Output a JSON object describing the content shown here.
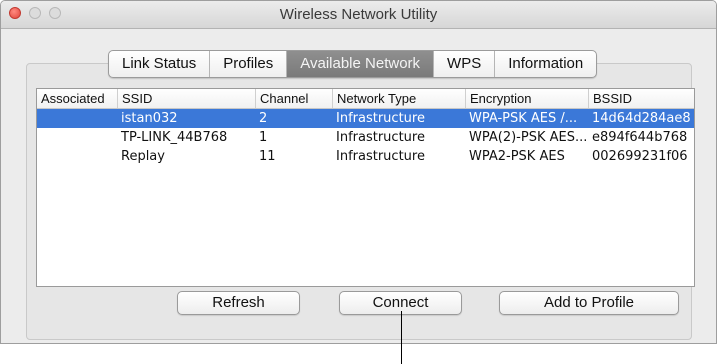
{
  "window": {
    "title": "Wireless Network Utility"
  },
  "tabs": [
    {
      "label": "Link Status",
      "active": false
    },
    {
      "label": "Profiles",
      "active": false
    },
    {
      "label": "Available Network",
      "active": true
    },
    {
      "label": "WPS",
      "active": false
    },
    {
      "label": "Information",
      "active": false
    }
  ],
  "table": {
    "columns": [
      "Associated",
      "SSID",
      "Channel",
      "Network Type",
      "Encryption",
      "BSSID"
    ],
    "rows": [
      {
        "associated": "",
        "ssid": "istan032",
        "channel": "2",
        "type": "Infrastructure",
        "encryption": "WPA-PSK AES /...",
        "bssid": "14d64d284ae8",
        "selected": true
      },
      {
        "associated": "",
        "ssid": "TP-LINK_44B768",
        "channel": "1",
        "type": "Infrastructure",
        "encryption": "WPA(2)-PSK AES...",
        "bssid": "e894f644b768",
        "selected": false
      },
      {
        "associated": "",
        "ssid": "Replay",
        "channel": "11",
        "type": "Infrastructure",
        "encryption": "WPA2-PSK AES",
        "bssid": "002699231f06",
        "selected": false
      }
    ]
  },
  "buttons": {
    "refresh": "Refresh",
    "connect": "Connect",
    "add_to_profile": "Add to Profile"
  },
  "colors": {
    "selection": "#3b78d8",
    "active_tab": "#7f7f7f",
    "close_light": "#e0443b"
  }
}
